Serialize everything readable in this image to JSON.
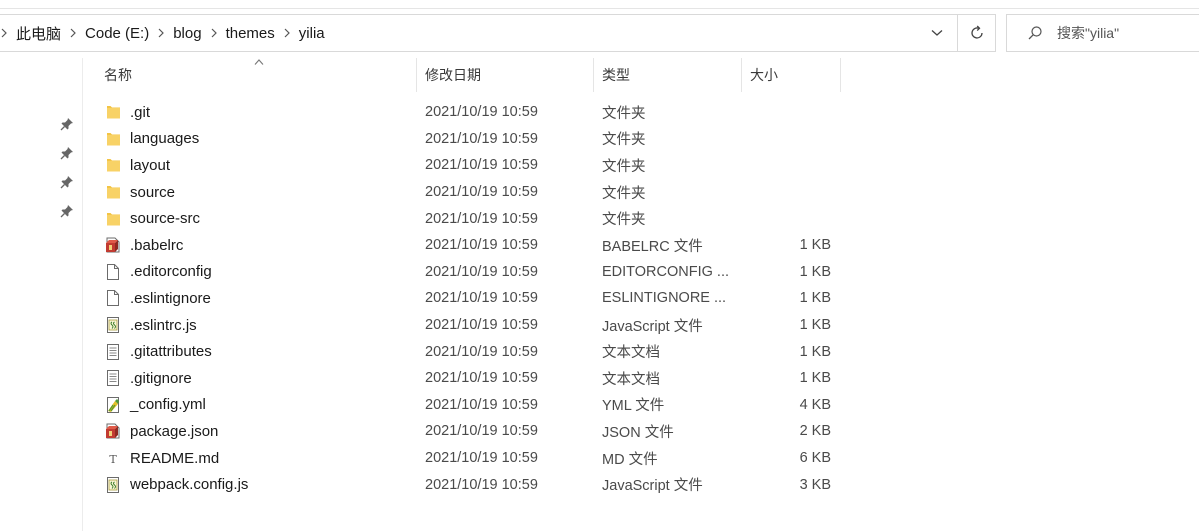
{
  "breadcrumb": [
    "此电脑",
    "Code (E:)",
    "blog",
    "themes",
    "yilia"
  ],
  "search": {
    "placeholder": "搜索\"yilia\""
  },
  "columns": {
    "name": "名称",
    "date": "修改日期",
    "type": "类型",
    "size": "大小"
  },
  "files": [
    {
      "name": ".git",
      "date": "2021/10/19 10:59",
      "type": "文件夹",
      "size": "",
      "icon": "folder-icon"
    },
    {
      "name": "languages",
      "date": "2021/10/19 10:59",
      "type": "文件夹",
      "size": "",
      "icon": "folder-icon"
    },
    {
      "name": "layout",
      "date": "2021/10/19 10:59",
      "type": "文件夹",
      "size": "",
      "icon": "folder-icon"
    },
    {
      "name": "source",
      "date": "2021/10/19 10:59",
      "type": "文件夹",
      "size": "",
      "icon": "folder-icon"
    },
    {
      "name": "source-src",
      "date": "2021/10/19 10:59",
      "type": "文件夹",
      "size": "",
      "icon": "folder-icon"
    },
    {
      "name": ".babelrc",
      "date": "2021/10/19 10:59",
      "type": "BABELRC 文件",
      "size": "1 KB",
      "icon": "package-icon"
    },
    {
      "name": ".editorconfig",
      "date": "2021/10/19 10:59",
      "type": "EDITORCONFIG ...",
      "size": "1 KB",
      "icon": "blank-file-icon"
    },
    {
      "name": ".eslintignore",
      "date": "2021/10/19 10:59",
      "type": "ESLINTIGNORE ...",
      "size": "1 KB",
      "icon": "blank-file-icon"
    },
    {
      "name": ".eslintrc.js",
      "date": "2021/10/19 10:59",
      "type": "JavaScript 文件",
      "size": "1 KB",
      "icon": "script-file-icon"
    },
    {
      "name": ".gitattributes",
      "date": "2021/10/19 10:59",
      "type": "文本文档",
      "size": "1 KB",
      "icon": "text-file-icon"
    },
    {
      "name": ".gitignore",
      "date": "2021/10/19 10:59",
      "type": "文本文档",
      "size": "1 KB",
      "icon": "text-file-icon"
    },
    {
      "name": "_config.yml",
      "date": "2021/10/19 10:59",
      "type": "YML 文件",
      "size": "4 KB",
      "icon": "yml-file-icon"
    },
    {
      "name": "package.json",
      "date": "2021/10/19 10:59",
      "type": "JSON 文件",
      "size": "2 KB",
      "icon": "package-icon"
    },
    {
      "name": "README.md",
      "date": "2021/10/19 10:59",
      "type": "MD 文件",
      "size": "6 KB",
      "icon": "markdown-file-icon"
    },
    {
      "name": "webpack.config.js",
      "date": "2021/10/19 10:59",
      "type": "JavaScript 文件",
      "size": "3 KB",
      "icon": "script-file-icon"
    }
  ],
  "colors": {
    "folder": "#f3c445",
    "border": "#d9d9d9",
    "text": "#1a1a1a"
  }
}
